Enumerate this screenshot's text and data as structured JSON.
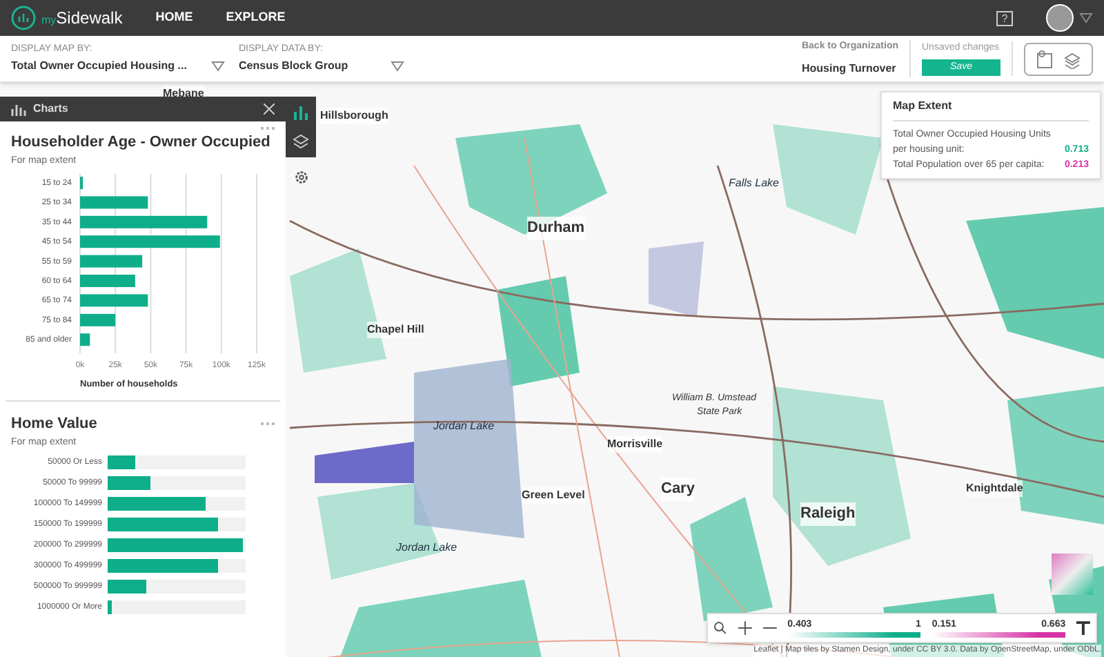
{
  "nav": {
    "logo": {
      "prefix": "my",
      "name": "Sidewalk"
    },
    "links": [
      "HOME",
      "EXPLORE"
    ]
  },
  "toolbar": {
    "map_by": {
      "label": "DISPLAY MAP BY:",
      "value": "Total Owner Occupied Housing ..."
    },
    "data_by": {
      "label": "DISPLAY DATA BY:",
      "value": "Census Block Group"
    },
    "back_link": "Back to Organization",
    "project": "Housing Turnover",
    "status": "Unsaved changes",
    "save": "Save"
  },
  "charts_panel": {
    "title": "Charts",
    "charts": [
      {
        "title": "Householder Age - Owner Occupied",
        "subtitle": "For map extent",
        "chart_data": {
          "type": "bar",
          "orientation": "horizontal",
          "xlabel": "Number of households",
          "categories": [
            "15 to 24",
            "25 to 34",
            "35 to 44",
            "45 to 54",
            "55 to 59",
            "60 to 64",
            "65 to 74",
            "75 to 84",
            "85 and older"
          ],
          "series": [
            {
              "color": "#0fae8a",
              "values": [
                2000,
                48000,
                90000,
                99000,
                44000,
                39000,
                48000,
                25000,
                7000
              ]
            }
          ],
          "xlim": [
            0,
            125000
          ],
          "grid": true,
          "xticks": [
            {
              "value": 0,
              "label": "0k"
            },
            {
              "value": 25000,
              "label": "25k"
            },
            {
              "value": 50000,
              "label": "50k"
            },
            {
              "value": 75000,
              "label": "75k"
            },
            {
              "value": 100000,
              "label": "100k"
            },
            {
              "value": 125000,
              "label": "125k"
            }
          ]
        }
      }
    ],
    "value_chart": {
      "title": "Home Value",
      "subtitle": "For map extent",
      "rows": [
        {
          "label": "50000 Or Less",
          "level": 0.2
        },
        {
          "label": "50000 To 99999",
          "level": 0.31
        },
        {
          "label": "100000 To 149999",
          "level": 0.71
        },
        {
          "label": "150000 To 199999",
          "level": 0.8
        },
        {
          "label": "200000 To 299999",
          "level": 0.98
        },
        {
          "label": "300000 To 499999",
          "level": 0.8
        },
        {
          "label": "500000 To 999999",
          "level": 0.28
        },
        {
          "label": "1000000 Or More",
          "level": 0.03
        }
      ]
    }
  },
  "map_labels": [
    {
      "text": "Mebane",
      "kind": "town"
    },
    {
      "text": "Hillsborough",
      "kind": "town"
    },
    {
      "text": "Durham",
      "kind": "city"
    },
    {
      "text": "Falls Lake",
      "kind": "water"
    },
    {
      "text": "Chapel Hill",
      "kind": "town"
    },
    {
      "text": "Jordan Lake",
      "kind": "water"
    },
    {
      "text": "William B. Umstead",
      "kind": "park"
    },
    {
      "text": "State Park",
      "kind": "park"
    },
    {
      "text": "Morrisville",
      "kind": "town"
    },
    {
      "text": "Cary",
      "kind": "city"
    },
    {
      "text": "Raleigh",
      "kind": "city"
    },
    {
      "text": "Green Level",
      "kind": "town"
    },
    {
      "text": "Knightdale",
      "kind": "town"
    },
    {
      "text": "Jordan Lake",
      "kind": "water"
    }
  ],
  "help_icon": "?",
  "map_extent": {
    "title": "Map Extent",
    "rows": [
      {
        "label": "Total Owner Occupied Housing Units per housing unit:",
        "value": "0.713",
        "color": "#0fae8a"
      },
      {
        "label": "Total Population over 65 per capita:",
        "value": "0.213",
        "color": "#d633a6"
      }
    ]
  },
  "legend": {
    "ranges": [
      {
        "min": "0.403",
        "max": "1",
        "color": "#0fae8a"
      },
      {
        "min": "0.151",
        "max": "0.663",
        "color": "#d633a6"
      }
    ]
  },
  "attribution": "Leaflet | Map tiles by Stamen Design, under CC BY 3.0. Data by OpenStreetMap, under ODbL."
}
